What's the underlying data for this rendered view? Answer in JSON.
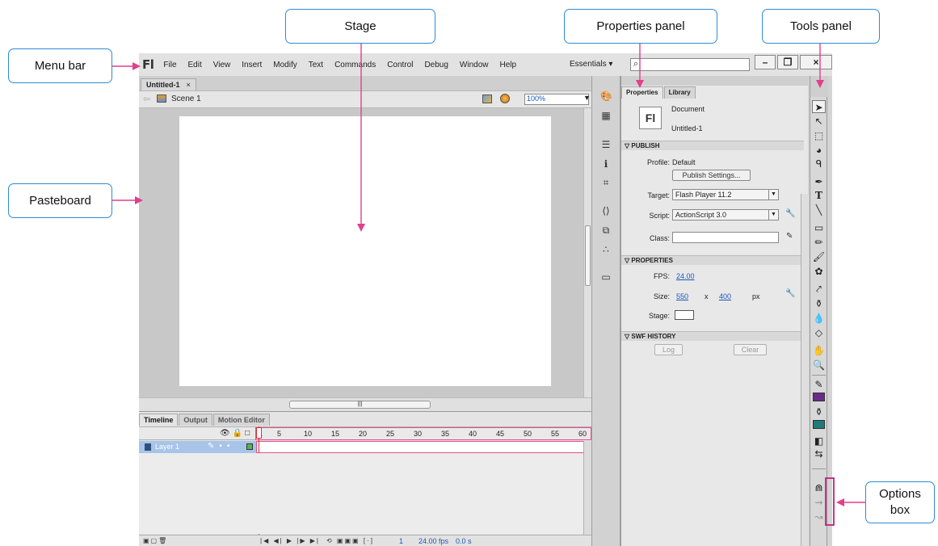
{
  "callouts": {
    "menu_bar": "Menu bar",
    "stage": "Stage",
    "properties_panel": "Properties panel",
    "tools_panel": "Tools panel",
    "pasteboard": "Pasteboard",
    "options_box_line1": "Options",
    "options_box_line2": "box",
    "callout_border_color": "#2e8bd6",
    "arrow_color": "#e0408c"
  },
  "app": {
    "logo": "Fl",
    "menu": [
      "File",
      "Edit",
      "View",
      "Insert",
      "Modify",
      "Text",
      "Commands",
      "Control",
      "Debug",
      "Window",
      "Help"
    ],
    "workspace": "Essentials",
    "search_placeholder": "",
    "window_buttons": {
      "minimize": "–",
      "restore": "❐",
      "close": "×"
    }
  },
  "document": {
    "tab_title": "Untitled-1",
    "tab_close": "×",
    "scene": "Scene 1",
    "zoom": "100%",
    "stage_color": "#ffffff",
    "pasteboard_color": "#c8c8c8"
  },
  "timeline": {
    "tabs": [
      "Timeline",
      "Output",
      "Motion Editor"
    ],
    "frame_numbers": [
      "1",
      "5",
      "10",
      "15",
      "20",
      "25",
      "30",
      "35",
      "40",
      "45",
      "50",
      "55",
      "60"
    ],
    "layer_name": "Layer 1",
    "layer_color": "#55b255",
    "status_frame": "1",
    "status_fps": "24.00 fps",
    "status_time": "0.0 s"
  },
  "properties": {
    "tabs": [
      "Properties",
      "Library"
    ],
    "doc_logo": "Fl",
    "doc_type": "Document",
    "doc_name": "Untitled-1",
    "publish": {
      "heading": "PUBLISH",
      "profile_label": "Profile:",
      "profile_value": "Default",
      "publish_settings_button": "Publish Settings...",
      "target_label": "Target:",
      "target_value": "Flash Player 11.2",
      "script_label": "Script:",
      "script_value": "ActionScript 3.0",
      "class_label": "Class:"
    },
    "props": {
      "heading": "PROPERTIES",
      "fps_label": "FPS:",
      "fps_value": "24.00",
      "size_label": "Size:",
      "width": "550",
      "times": "x",
      "height": "400",
      "unit": "px",
      "stage_label": "Stage:",
      "stage_color": "#ffffff"
    },
    "swf_history": {
      "heading": "SWF HISTORY",
      "log_button": "Log",
      "clear_button": "Clear"
    }
  },
  "tools": {
    "stroke_color": "#6b2a8a",
    "fill_color": "#1f7a78"
  }
}
